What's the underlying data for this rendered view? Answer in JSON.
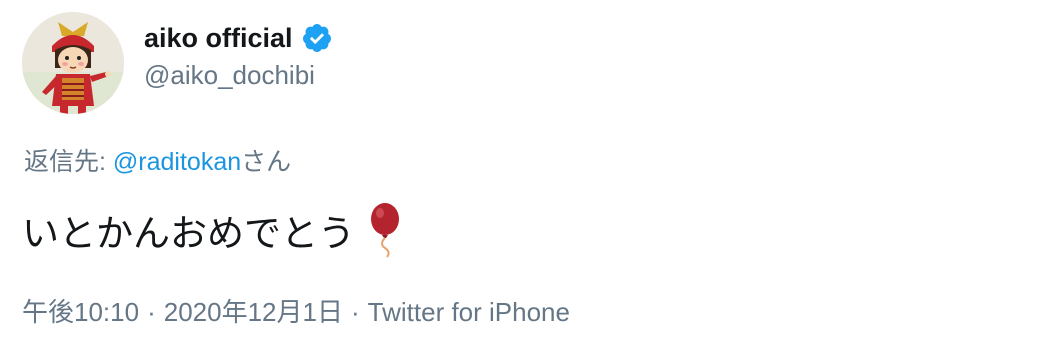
{
  "user": {
    "display_name": "aiko official",
    "handle": "@aiko_dochibi",
    "verified": true,
    "avatar_icon": "samurai-doll-avatar-icon"
  },
  "reply": {
    "prefix": "返信先: ",
    "mention": "@raditokan",
    "suffix": "さん"
  },
  "tweet": {
    "text": "いとかんおめでとう",
    "emoji_icon": "balloon-icon"
  },
  "meta": {
    "time": "午後10:10",
    "separator": "·",
    "date": "2020年12月1日",
    "source": "Twitter for iPhone"
  },
  "colors": {
    "text": "#14171a",
    "secondary": "#657786",
    "link": "#1b95e0",
    "verified": "#1da1f2",
    "balloon": "#b3242f"
  }
}
